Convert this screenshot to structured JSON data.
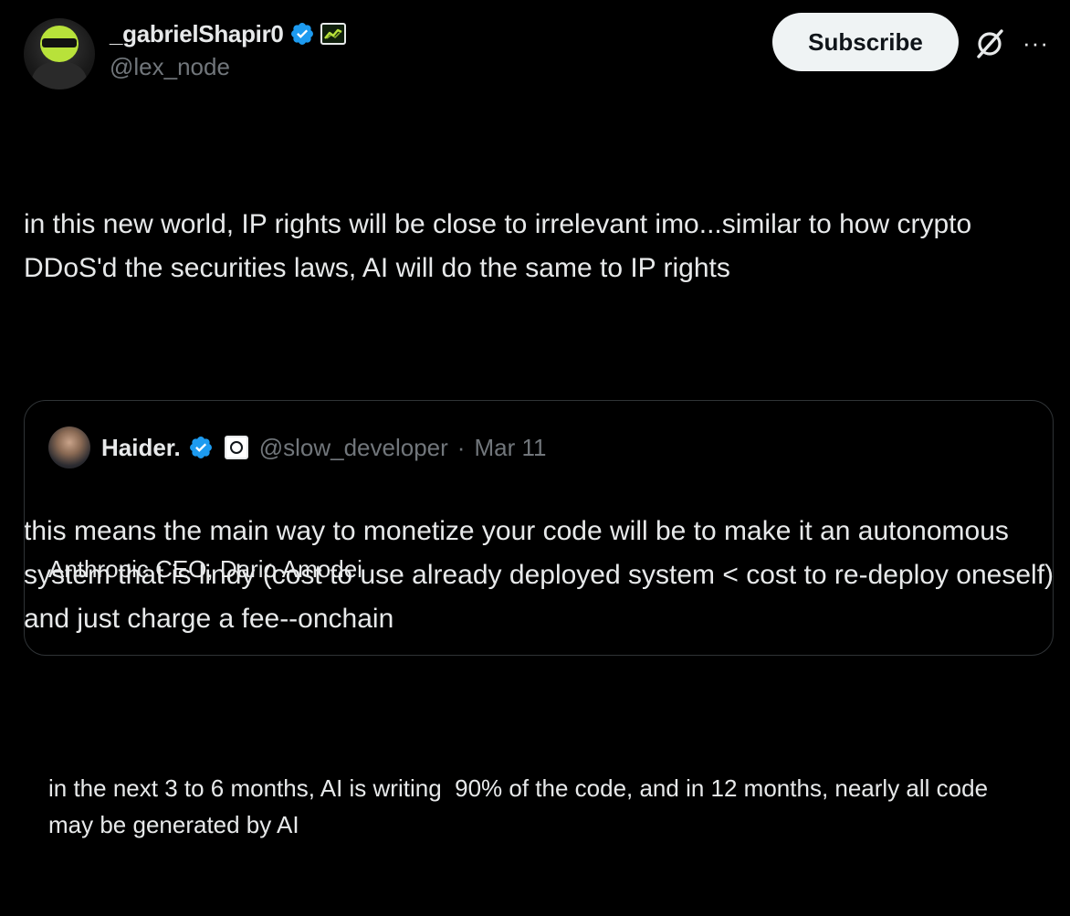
{
  "author": {
    "display_name": "_gabrielShapir0",
    "handle": "@lex_node",
    "verified": true,
    "verified_color": "#1d9bf0",
    "affiliate_badge_icon": "chart-line-icon",
    "avatar_icon": "helmet-avatar"
  },
  "actions": {
    "subscribe_label": "Subscribe",
    "grok_icon": "grok-slash-icon",
    "more_icon": "more-horizontal-icon",
    "more_glyph": "···"
  },
  "tweet": {
    "paragraph_1": "in this new world, IP rights will be close to irrelevant imo...similar to how crypto DDoS'd the securities laws, AI will do the same to IP rights",
    "paragraph_2": "this means the main way to monetize your code will be to make it an autonomous system that is lindy (cost to use already deployed system < cost to re-deploy oneself) and just charge a fee--onchain"
  },
  "quote": {
    "display_name": "Haider.",
    "handle": "@slow_developer",
    "separator": "·",
    "date": "Mar 11",
    "verified": true,
    "affiliate_badge_icon": "circle-square-icon",
    "line_1": "Anthropic CEO, Dario Amodei",
    "line_2": "in the next 3 to 6 months, AI is writing  90% of the code, and in 12 months, nearly all code may be generated by AI"
  },
  "colors": {
    "background": "#000000",
    "text_primary": "#e7e9ea",
    "text_secondary": "#71767b",
    "border": "#2f3336",
    "button_bg": "#eff3f4",
    "button_text": "#0f1419"
  }
}
